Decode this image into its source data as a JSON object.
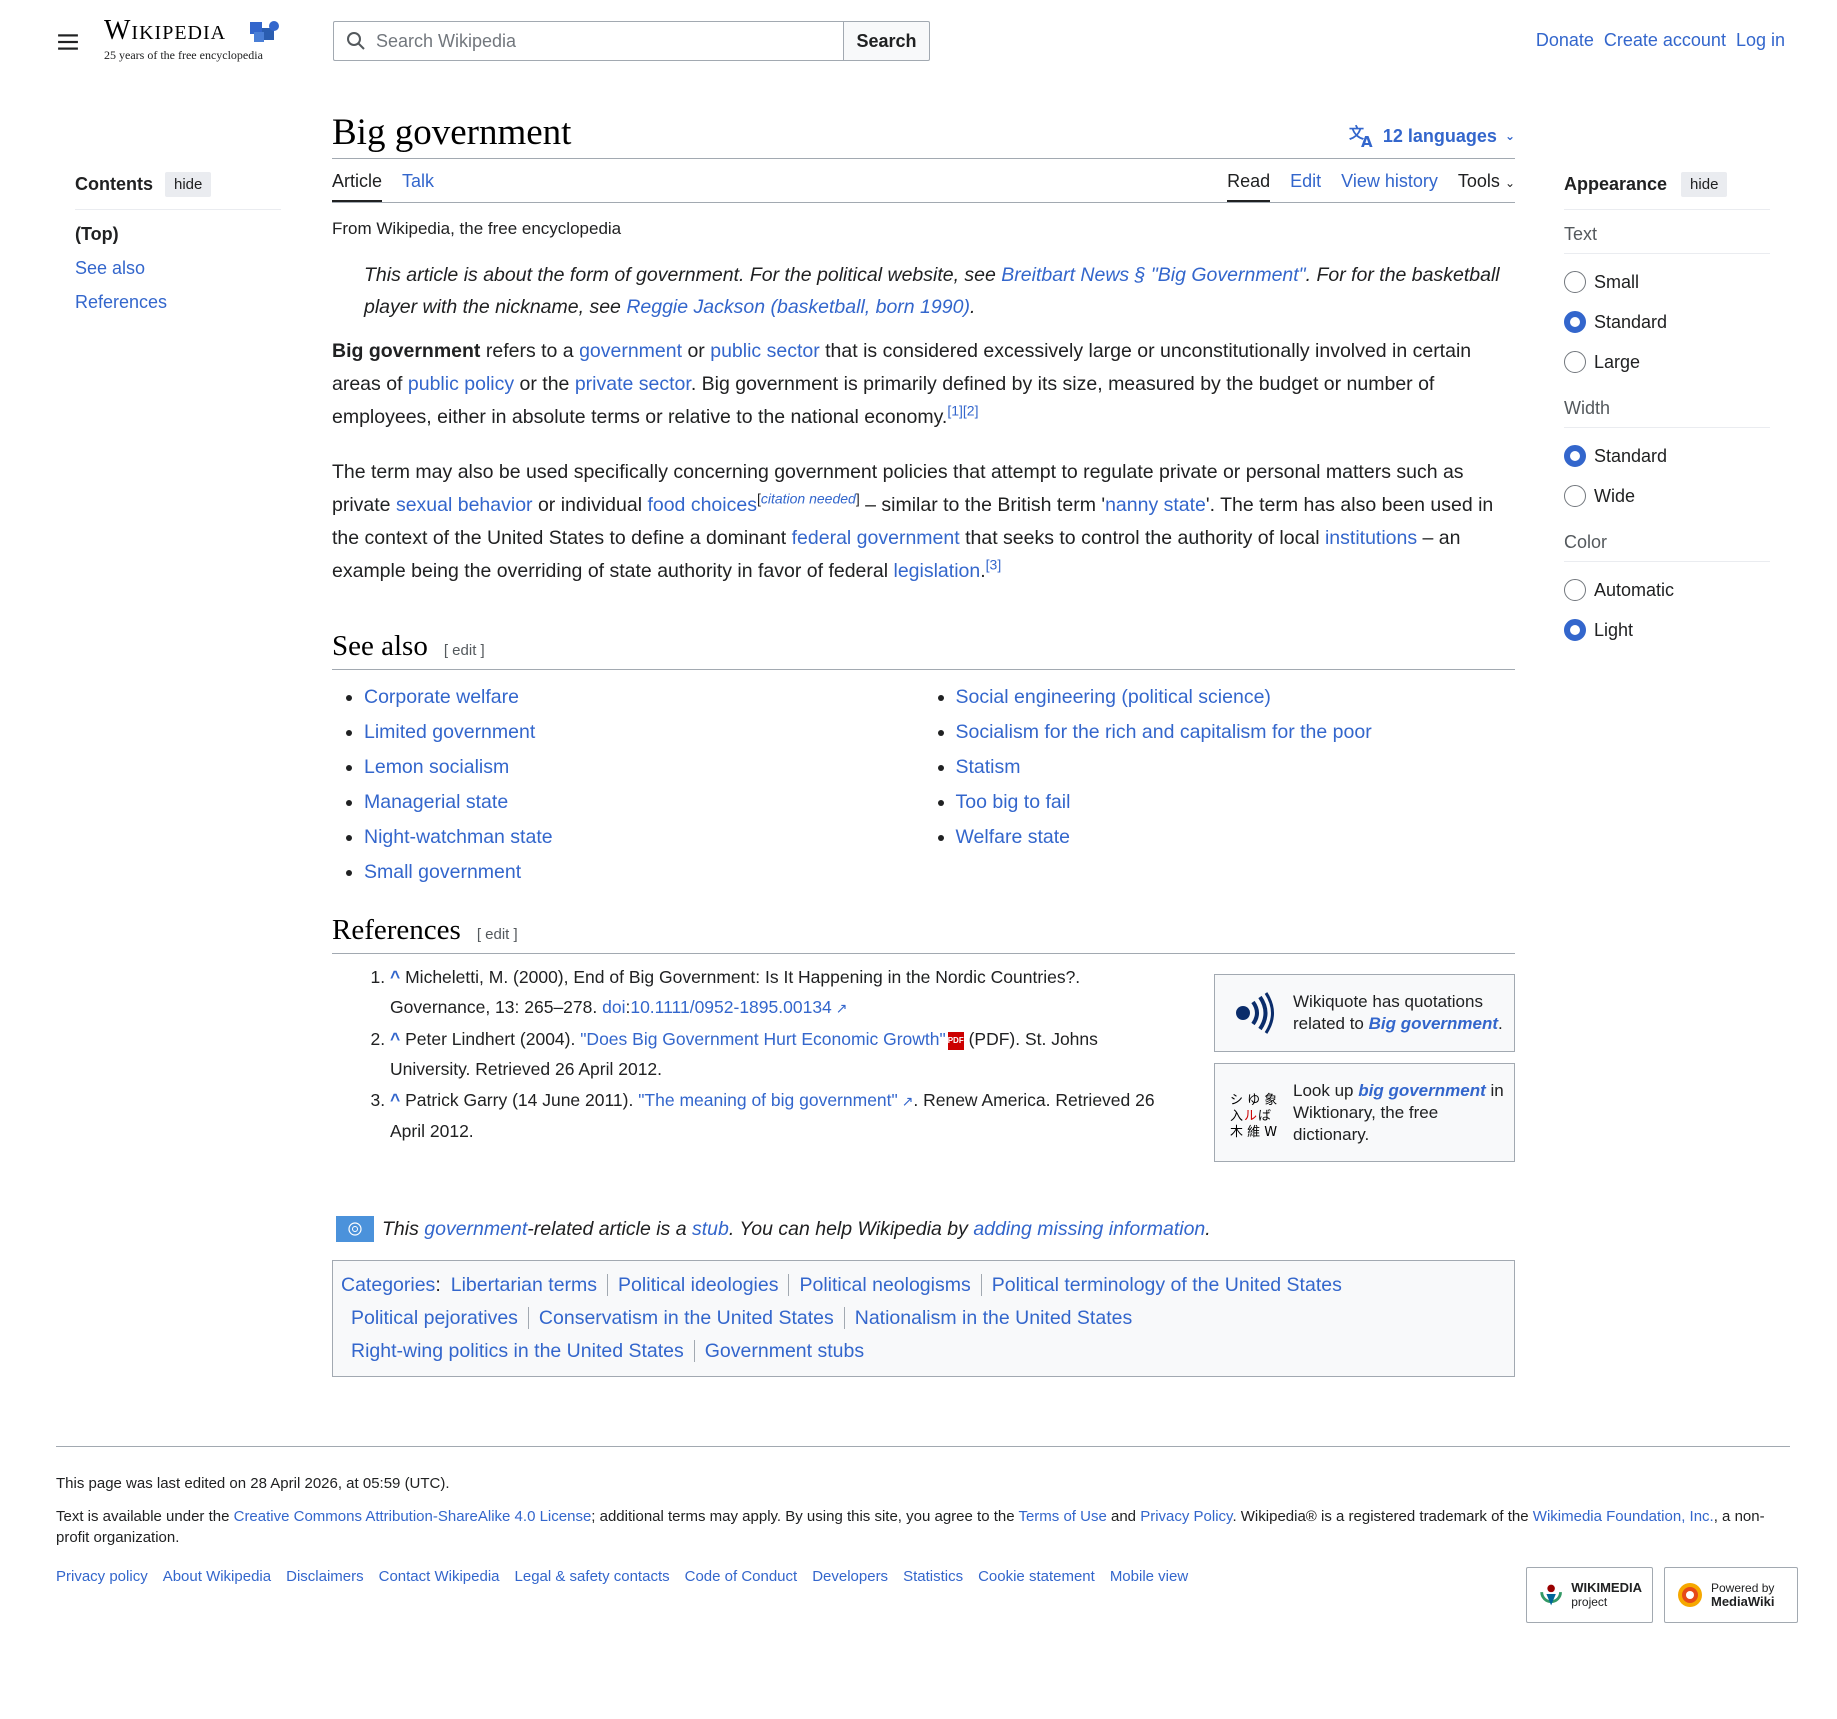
{
  "header": {
    "logo_wordmark": "Wikipedia",
    "logo_tagline": "25 years of the free encyclopedia",
    "search_placeholder": "Search Wikipedia",
    "search_button": "Search",
    "user_links": [
      "Donate",
      "Create account",
      "Log in"
    ]
  },
  "toc": {
    "title": "Contents",
    "hide": "hide",
    "items": [
      "(Top)",
      "See also",
      "References"
    ]
  },
  "article": {
    "title": "Big government",
    "languages": "12 languages",
    "tabs_left": [
      "Article",
      "Talk"
    ],
    "tabs_right": [
      "Read",
      "Edit",
      "View history",
      "Tools"
    ],
    "from": "From Wikipedia, the free encyclopedia",
    "hatnote": {
      "t1": "This article is about the form of government. For the political website, see ",
      "l1": "Breitbart News § \"Big Government\"",
      "t2": ". For for the basketball player with the nickname, see ",
      "l2": "Reggie Jackson (basketball, born 1990)",
      "t3": "."
    },
    "p1": {
      "b": "Big government",
      "t1": " refers to a ",
      "l1": "government",
      "t2": " or ",
      "l2": "public sector",
      "t3": " that is considered excessively large or unconstitutionally involved in certain areas of ",
      "l3": "public policy",
      "t4": " or the ",
      "l4": "private sector",
      "t5": ". Big government is primarily defined by its size, measured by the budget or number of employees, either in absolute terms or relative to the national economy.",
      "s1": "[1]",
      "s2": "[2]"
    },
    "p2": {
      "t1": "The term may also be used specifically concerning government policies that attempt to regulate private or personal matters such as private ",
      "l1": "sexual behavior",
      "t2": " or individual ",
      "l2": "food choices",
      "cn_open": "[",
      "cn": "citation needed",
      "cn_close": "]",
      "t3": " – similar to the British term '",
      "l3": "nanny state",
      "t4": "'. The term has also been used in the context of the United States to define a dominant ",
      "l4": "federal government",
      "t5": " that seeks to control the authority of local ",
      "l5": "institutions",
      "t6": " – an example being the overriding of state authority in favor of federal ",
      "l6": "legislation",
      "t7": ".",
      "s1": "[3]"
    },
    "see_also": {
      "heading": "See also",
      "edit": "[ edit ]",
      "col1": [
        "Corporate welfare",
        "Limited government",
        "Lemon socialism",
        "Managerial state",
        "Night-watchman state",
        "Small government"
      ],
      "col2": [
        "Social engineering (political science)",
        "Socialism for the rich and capitalism for the poor",
        "Statism",
        "Too big to fail",
        "Welfare state"
      ]
    },
    "references": {
      "heading": "References",
      "edit": "[ edit ]",
      "r1": {
        "text": "Micheletti, M. (2000), End of Big Government: Is It Happening in the Nordic Countries?. Governance, 13: 265–278. ",
        "doi": "doi",
        "doi_sep": ":",
        "doi_link": "10.1111/0952-1895.00134"
      },
      "r2": {
        "t1": "Peter Lindhert (2004). ",
        "link": "\"Does Big Government Hurt Economic Growth\"",
        "t2": " (PDF). St. Johns University. Retrieved 26 April 2012."
      },
      "r3": {
        "t1": "Patrick Garry (14 June 2011). ",
        "link": "\"The meaning of big government\"",
        "t2": ". Renew America. Retrieved 26 April 2012."
      }
    },
    "wikiquote": {
      "t1": "Wikiquote has quotations related to ",
      "link": "Big government",
      "t2": "."
    },
    "wiktionary": {
      "t1": "Look up ",
      "link": "big government",
      "t2": " in Wiktionary, the free dictionary."
    },
    "stub": {
      "t1": "This ",
      "l1": "government",
      "t2": "-related article is a ",
      "l2": "stub",
      "t3": ". You can help Wikipedia by ",
      "l3": "adding missing information",
      "t4": "."
    },
    "categories": {
      "label": "Categories",
      "items": [
        "Libertarian terms",
        "Political ideologies",
        "Political neologisms",
        "Political terminology of the United States",
        "Political pejoratives",
        "Conservatism in the United States",
        "Nationalism in the United States",
        "Right-wing politics in the United States",
        "Government stubs"
      ]
    }
  },
  "appearance": {
    "title": "Appearance",
    "hide": "hide",
    "text_label": "Text",
    "text_options": [
      "Small",
      "Standard",
      "Large"
    ],
    "width_label": "Width",
    "width_options": [
      "Standard",
      "Wide"
    ],
    "color_label": "Color",
    "color_options": [
      "Automatic",
      "Light"
    ]
  },
  "footer": {
    "last_edited": "This page was last edited on 28 April 2026, at 05:59 (UTC).",
    "license": {
      "t1": "Text is available under the ",
      "l1": "Creative Commons Attribution-ShareAlike 4.0 License",
      "t2": "; additional terms may apply. By using this site, you agree to the ",
      "l2": "Terms of Use",
      "t3": " and ",
      "l3": "Privacy Policy",
      "t4": ". Wikipedia® is a registered trademark of the ",
      "l4": "Wikimedia Foundation, Inc.",
      "t5": ", a non-profit organization."
    },
    "links": [
      "Privacy policy",
      "About Wikipedia",
      "Disclaimers",
      "Contact Wikipedia",
      "Legal & safety contacts",
      "Code of Conduct",
      "Developers",
      "Statistics",
      "Cookie statement",
      "Mobile view"
    ],
    "wikimedia_badge": {
      "t1": "WIKIMEDIA",
      "t2": "project"
    },
    "mediawiki_badge": {
      "t1": "Powered by",
      "t2": "MediaWiki"
    }
  },
  "colors": {
    "link": "#3366cc",
    "text": "#202122",
    "border": "#a2a9b1"
  }
}
